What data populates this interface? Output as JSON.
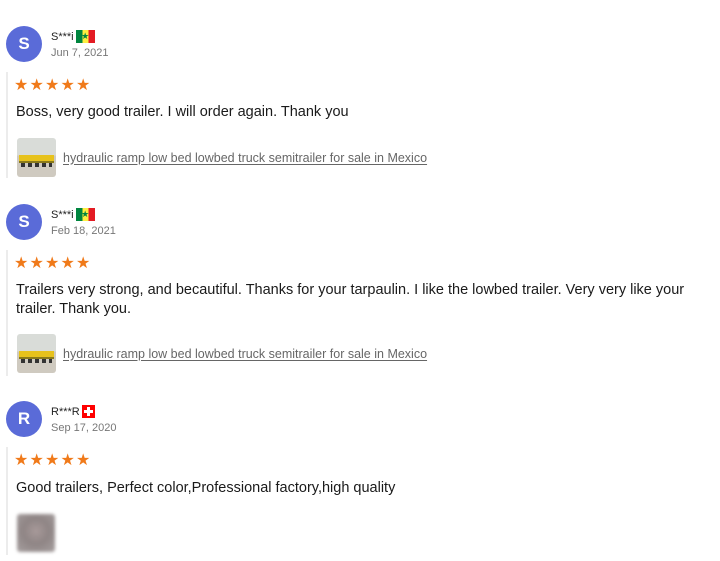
{
  "reviews": [
    {
      "initial": "S",
      "name": "S***i",
      "country_flag": "senegal-flag",
      "date": "Jun 7, 2021",
      "rating": 5,
      "text": "Boss, very good trailer. I will order again. Thank you",
      "product_link": "hydraulic ramp low bed lowbed truck semitrailer for sale in Mexico"
    },
    {
      "initial": "S",
      "name": "S***i",
      "country_flag": "senegal-flag",
      "date": "Feb 18, 2021",
      "rating": 5,
      "text": "Trailers very strong, and becautiful. Thanks for your tarpaulin. I like the lowbed trailer. Very very like your trailer. Thank you.",
      "product_link": "hydraulic ramp low bed lowbed truck semitrailer for sale in Mexico"
    },
    {
      "initial": "R",
      "name": "R***R",
      "country_flag": "switzerland-flag",
      "date": "Sep 17, 2020",
      "rating": 5,
      "text": "Good trailers, Perfect color,Professional factory,high quality",
      "photo": "blurred-photo-thumbnail"
    }
  ],
  "colors": {
    "avatar": "#5a6bd8",
    "star": "#f07a1a",
    "link": "#666666"
  },
  "icons": {
    "star": "star-icon"
  }
}
